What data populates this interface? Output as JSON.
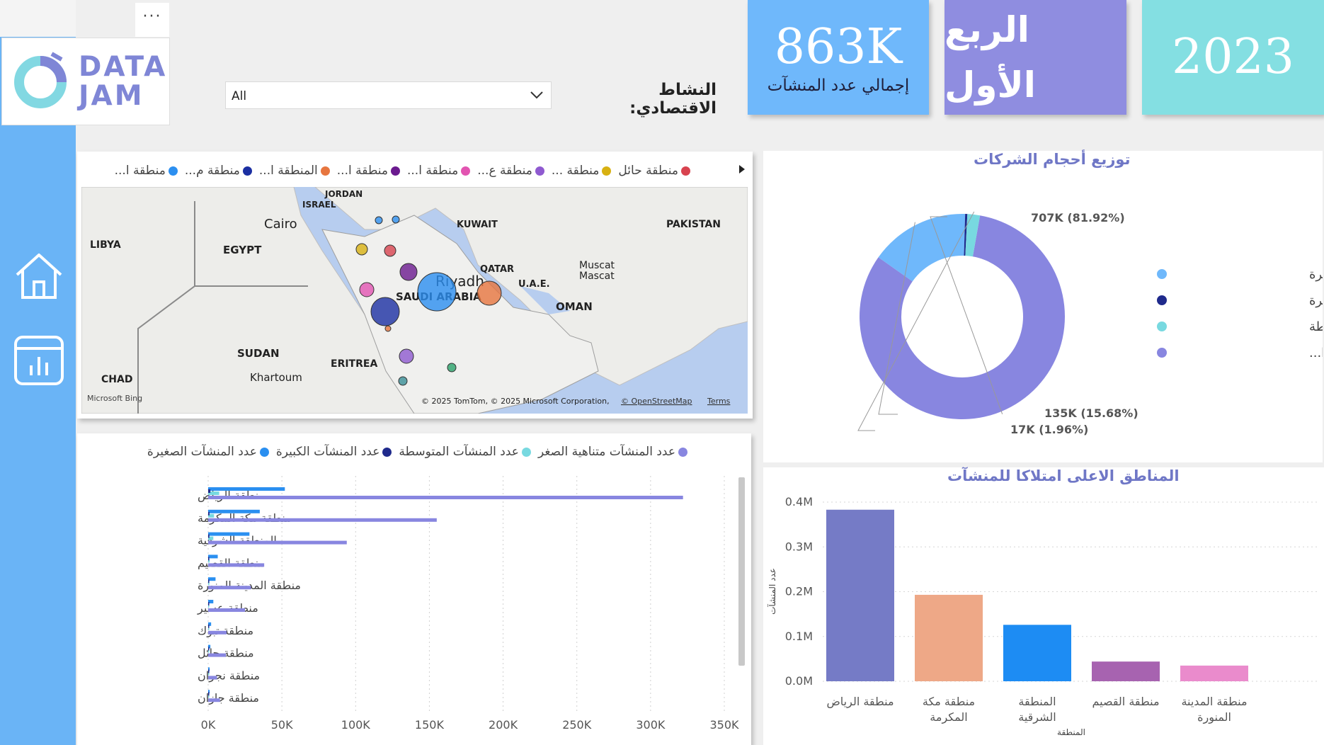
{
  "brand": {
    "logo_line1": "DATA",
    "logo_line2": "JAM"
  },
  "header": {
    "more_label": "···",
    "filter_label": "النشاط الاقتصادي:",
    "filter_value": "All"
  },
  "kpis": [
    {
      "value": "863K",
      "label": "إجمالي عدد المنشآت",
      "color": "#6fb8fb"
    },
    {
      "value": "الربع الأول",
      "label": "",
      "color": "#8f8de0"
    },
    {
      "value": "2023",
      "label": "",
      "color": "#84dfe2"
    }
  ],
  "nav": [
    {
      "icon": "home-icon"
    },
    {
      "icon": "report-icon"
    }
  ],
  "map": {
    "legend": [
      {
        "label": "منطقة حائل",
        "color": "#d8434f"
      },
      {
        "label": "منطقة ...",
        "color": "#d8b112"
      },
      {
        "label": "منطقة ع...",
        "color": "#8f5ad0"
      },
      {
        "label": "منطقة ا...",
        "color": "#e254b1"
      },
      {
        "label": "منطقة ا...",
        "color": "#6b1a8f"
      },
      {
        "label": "المنطقة ا...",
        "color": "#e7763f"
      },
      {
        "label": "منطقة م...",
        "color": "#1b2fa2"
      },
      {
        "label": "منطقة ا...",
        "color": "#2c8ff0"
      }
    ],
    "labels": [
      {
        "text": "JORDAN"
      },
      {
        "text": "ISRAEL"
      },
      {
        "text": "Cairo"
      },
      {
        "text": "KUWAIT"
      },
      {
        "text": "PAKISTAN"
      },
      {
        "text": "LIBYA"
      },
      {
        "text": "EGYPT"
      },
      {
        "text": "QATAR"
      },
      {
        "text": "Muscat"
      },
      {
        "text": "Mascat"
      },
      {
        "text": "Riyadh"
      },
      {
        "text": "U.A.E."
      },
      {
        "text": "SAUDI ARABIA"
      },
      {
        "text": "OMAN"
      },
      {
        "text": "SUDAN"
      },
      {
        "text": "ERITREA"
      },
      {
        "text": "CHAD"
      },
      {
        "text": "Khartoum"
      }
    ],
    "bing": "Microsoft Bing",
    "copyright": "© 2025 TomTom, © 2025 Microsoft Corporation,",
    "osm": "© OpenStreetMap",
    "terms": "Terms"
  },
  "donut": {
    "title": "توزيع أحجام الشركات",
    "legend": [
      {
        "label": "عدد المنشآت الصغيرة",
        "color": "#6fb8fb"
      },
      {
        "label": "عدد المنشآت الكبيرة",
        "color": "#1f2a8c"
      },
      {
        "label": "عدد المنشآت المتوسطة",
        "color": "#78d9e0"
      },
      {
        "label": "عدد المنشآت متناهية ا...",
        "color": "#8886e0"
      }
    ],
    "labels": {
      "micro": "707K (81.92%)",
      "small": "135K (15.68%)",
      "medium": "17K (1.96%)"
    }
  },
  "hbar": {
    "legend": [
      {
        "label": "عدد المنشآت متناهية الصغر",
        "color": "#8886e0"
      },
      {
        "label": "عدد المنشآت المتوسطة",
        "color": "#78d9e0"
      },
      {
        "label": "عدد المنشآت الكبيرة",
        "color": "#1f2a8c"
      },
      {
        "label": "عدد المنشآت الصغيرة",
        "color": "#2a8ff0"
      }
    ]
  },
  "vbar": {
    "title": "المناطق الاعلى امتلاكا للمنشآت",
    "ylabel": "عدد المنشآت",
    "xlabel": "المنطقة"
  },
  "chart_data": [
    {
      "type": "pie",
      "title": "توزيع أحجام الشركات",
      "categories": [
        "عدد المنشآت متناهية الصغر",
        "عدد المنشآت الصغيرة",
        "عدد المنشآت الكبيرة",
        "عدد المنشآت المتوسطة"
      ],
      "values": [
        707,
        135,
        3,
        17
      ],
      "value_labels": [
        "707K (81.92%)",
        "135K (15.68%)",
        "",
        "17K (1.96%)"
      ],
      "colors": [
        "#8886e0",
        "#6fb8fb",
        "#1f2a8c",
        "#78d9e0"
      ],
      "legend": "right"
    },
    {
      "type": "bar",
      "orientation": "horizontal",
      "categories": [
        "منطقة الرياض",
        "منطقة مكة المكرمة",
        "المنطقة الشرقية",
        "منطقة القصيم",
        "منطقة المدينة المنورة",
        "منطقة عسير",
        "منطقة تبوك",
        "منطقة حائل",
        "منطقة نجران",
        "منطقة جازان"
      ],
      "series": [
        {
          "name": "عدد المنشآت متناهية الصغر",
          "color": "#8886e0",
          "values": [
            322000,
            155000,
            94000,
            38000,
            29000,
            25000,
            12500,
            12000,
            6000,
            8000
          ]
        },
        {
          "name": "عدد المنشآت الصغيرة",
          "color": "#2a8ff0",
          "values": [
            52000,
            35000,
            28000,
            6500,
            5000,
            3500,
            2000,
            1500,
            1000,
            1000
          ]
        },
        {
          "name": "عدد المنشآت المتوسطة",
          "color": "#78d9e0",
          "values": [
            7500,
            4000,
            3500,
            1000,
            800,
            500,
            300,
            300,
            200,
            200
          ]
        },
        {
          "name": "عدد المنشآت الكبيرة",
          "color": "#1f2a8c",
          "values": [
            1500,
            900,
            800,
            200,
            200,
            100,
            80,
            80,
            50,
            50
          ]
        }
      ],
      "xlim": [
        0,
        350000
      ],
      "xticks": [
        "0K",
        "50K",
        "100K",
        "150K",
        "200K",
        "250K",
        "300K",
        "350K"
      ],
      "legend": "top"
    },
    {
      "type": "bar",
      "title": "المناطق الاعلى امتلاكا للمنشآت",
      "categories": [
        "منطقة الرياض",
        "منطقة مكة المكرمة",
        "المنطقة الشرقية",
        "منطقة القصيم",
        "منطقة المدينة المنورة"
      ],
      "values": [
        383000,
        193000,
        126000,
        44000,
        35000
      ],
      "colors": [
        "#757bc6",
        "#eea887",
        "#1d8cf3",
        "#a763b0",
        "#ea8bcc"
      ],
      "ylim": [
        0,
        400000
      ],
      "yticks": [
        "0.0M",
        "0.1M",
        "0.2M",
        "0.3M",
        "0.4M"
      ],
      "ylabel": "عدد المنشآت",
      "xlabel": "المنطقة"
    }
  ]
}
